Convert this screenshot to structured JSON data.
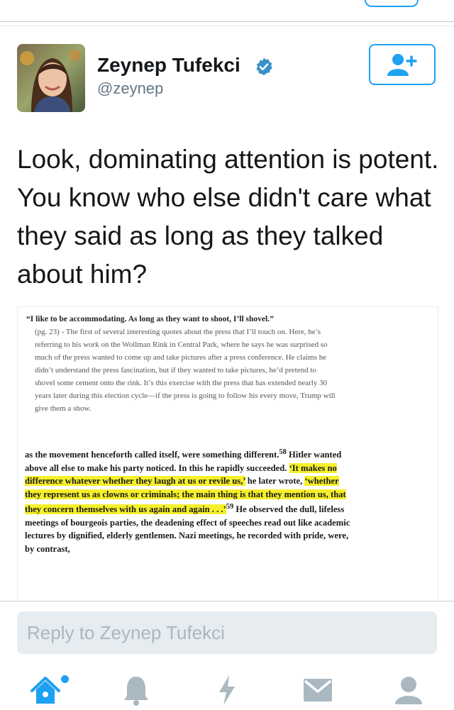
{
  "profile": {
    "name": "Zeynep Tufekci",
    "handle": "@zeynep",
    "verified": true,
    "avatar_icon": "person-photo"
  },
  "follow_button": {
    "icon": "add-user-icon"
  },
  "tweet": {
    "text": "Look, dominating attention is potent. You know who else didn't care what they said as long as they talked about him?"
  },
  "media": {
    "quote1": {
      "lead": "“I like to be accommodating. As long as they want to shoot, I’ll shovel.”",
      "page_ref": "(pg. 23)",
      "body": " - The first of several interesting quotes about the press that I’ll touch on. Here, he’s referring to his work on the Wollman Rink in Central Park, where he says he was surprised so much of the press wanted to come up and take pictures after a press conference. He claims he didn’t understand the press fascination, but if they wanted to take pictures, he’d pretend to shovel some cement onto the rink. It’s this exercise with the press that has extended nearly 30 years later during this election cycle—if the press is going to follow his every move, Trump will give them a show."
    },
    "quote2": {
      "part1": "as the movement henceforth called itself, were something different.",
      "fn58": "58",
      "part2": " Hitler wanted above all else to make his party noticed. In this he rapidly succeeded. ",
      "hl1": "‘It makes no difference whatever whether they laugh at us or revile us,’",
      "part3": " he later wrote, ",
      "hl2": "‘whether they represent us as clowns or criminals; the main thing is that they mention us, that they concern themselves with us again and again . . .’",
      "fn59": "59",
      "part4": " He observed the dull, lifeless meetings of bourgeois parties, the deadening effect of speeches read out like academic lectures by dignified, elderly gentlemen. Nazi meetings, he recorded with pride, were, by contrast,"
    }
  },
  "reply": {
    "placeholder": "Reply to Zeynep Tufekci"
  },
  "nav": {
    "items": [
      "home-icon",
      "bell-icon",
      "lightning-icon",
      "mail-icon",
      "profile-icon"
    ],
    "accent": "#1da1f2",
    "inactive": "#aab8c2"
  }
}
